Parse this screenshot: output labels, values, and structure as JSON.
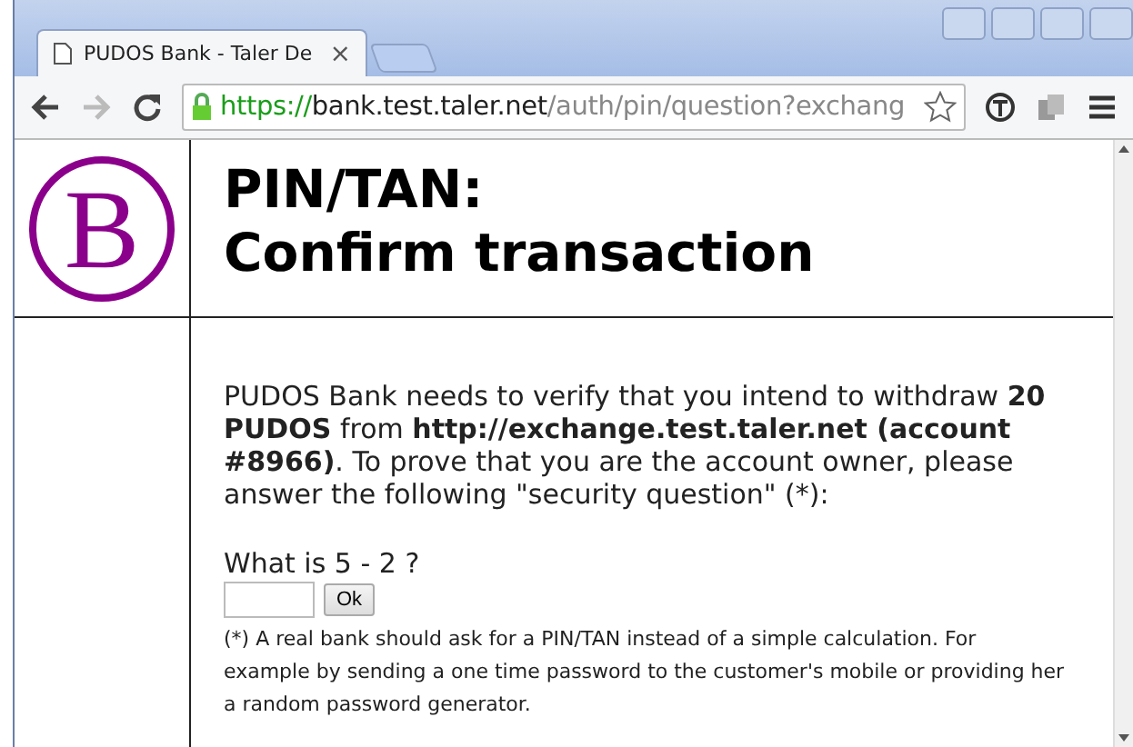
{
  "tabs": [
    {
      "title": "PUDOS Bank - Taler De",
      "selected": true,
      "close": "×"
    }
  ],
  "address": {
    "scheme": "https://",
    "host": "bank.test.taler.net",
    "path": "/auth/pin/question?exchang",
    "secure": true
  },
  "logo": {
    "letter": "B"
  },
  "heading": [
    "PIN/TAN:",
    "Confirm transaction"
  ],
  "message": "PUDOS Bank needs to verify that you intend to withdraw **20 PUDOS** from **http://exchange.test.taler.net (account #8966)**. To prove that you are the account owner, please answer the following \"security question\" (*):",
  "question": "What is 5 - 2 ?",
  "submit": "Ok",
  "footnote": "(*) A real bank should ask for a PIN/TAN instead of a simple calculation. For example by sending a one time password to the customer's mobile or providing her a random password generator."
}
